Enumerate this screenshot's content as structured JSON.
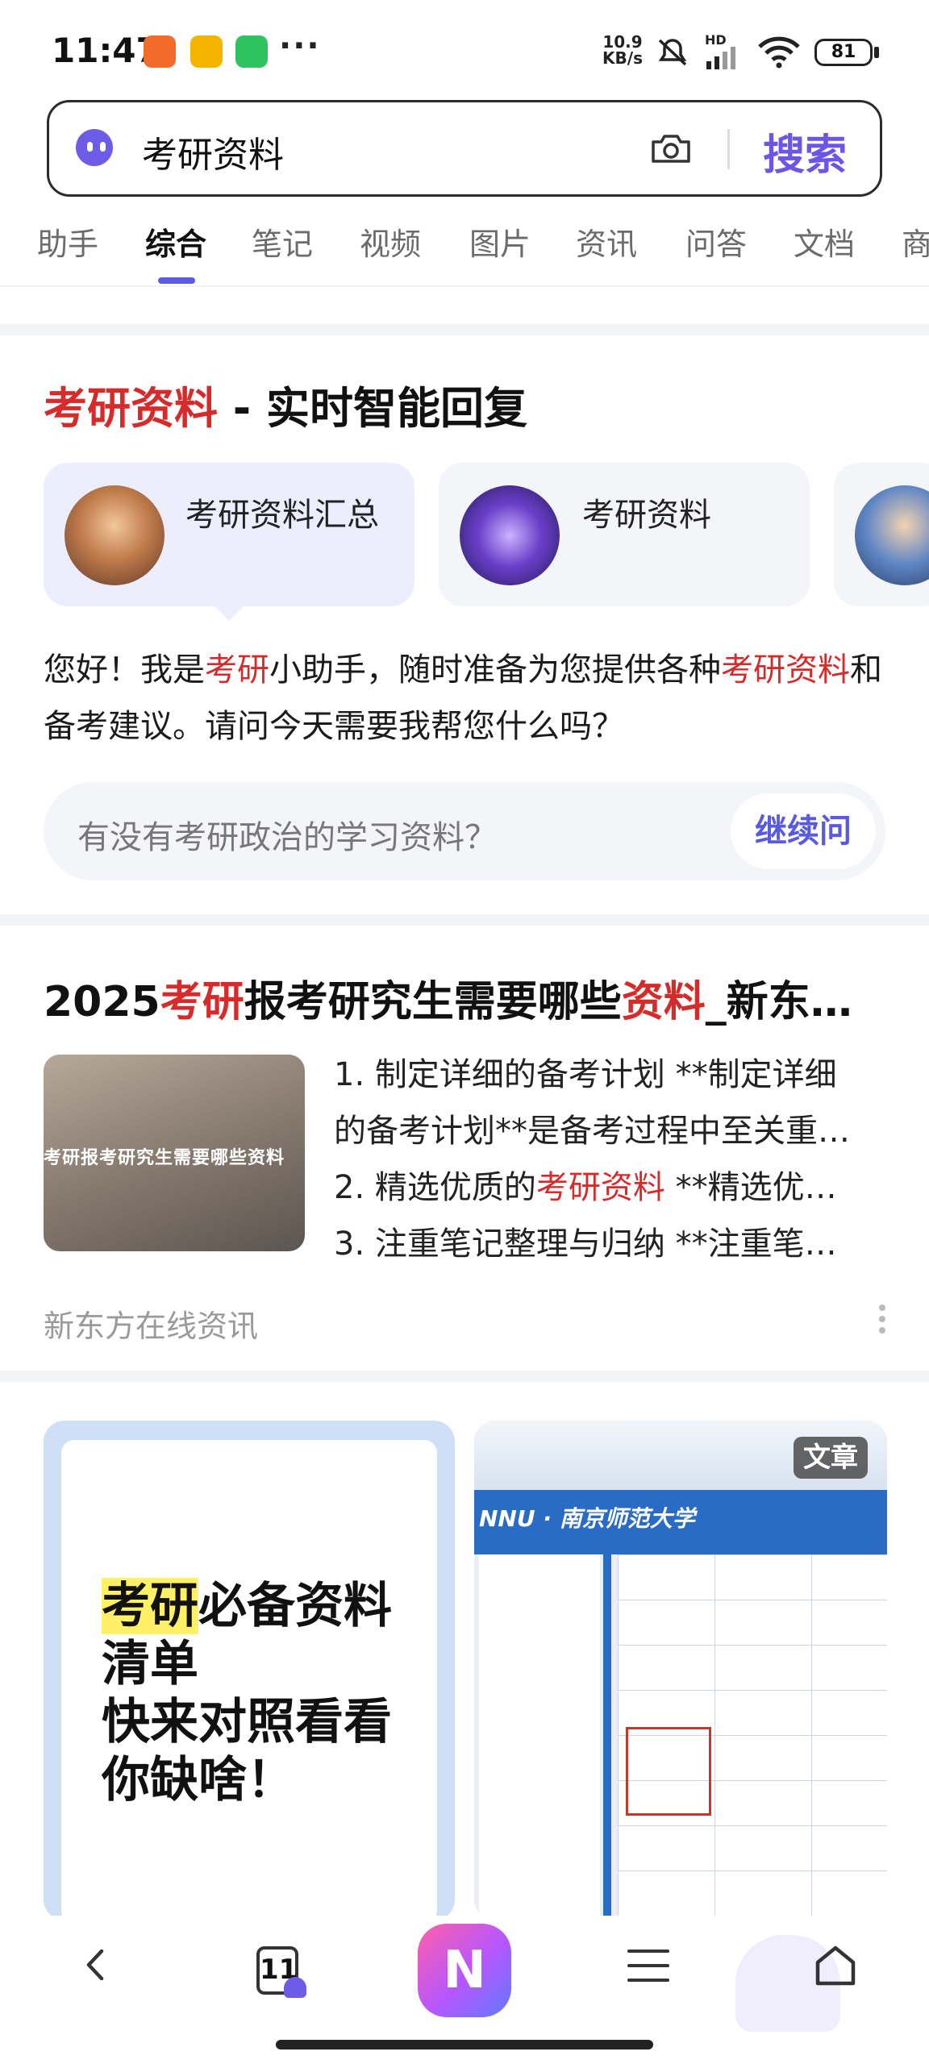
{
  "status_bar": {
    "time": "11:47",
    "more": "···",
    "speed_value": "10.9",
    "speed_unit": "KB/s",
    "network": "HD",
    "battery": "81"
  },
  "search": {
    "query": "考研资料",
    "button": "搜索"
  },
  "tabs": [
    {
      "label": "助手"
    },
    {
      "label": "综合"
    },
    {
      "label": "笔记"
    },
    {
      "label": "视频"
    },
    {
      "label": "图片"
    },
    {
      "label": "资讯"
    },
    {
      "label": "问答"
    },
    {
      "label": "文档"
    },
    {
      "label": "商"
    }
  ],
  "active_tab": "综合",
  "ai_card": {
    "title_highlight": "考研资料",
    "title_rest": " - 实时智能回复",
    "chips": [
      {
        "label": "考研资料汇总"
      },
      {
        "label": "考研资料"
      },
      {
        "label": ""
      }
    ],
    "body": {
      "p1": "您好！我是",
      "hl1": "考研",
      "p2": "小助手，随时准备为您提供各种",
      "hl2": "考研资料",
      "p3": "和备考建议。请问今天需要我帮您什么吗？"
    },
    "ask_placeholder": "有没有考研政治的学习资料？",
    "ask_button": "继续问"
  },
  "result": {
    "title_a": "2025",
    "title_hl1": "考研",
    "title_b": "报考研究生需要哪些",
    "title_hl2": "资料",
    "title_c": "_新东…",
    "thumb_text": "考研报考研究生需要哪些资料",
    "line1": "1. 制定详细的备考计划 **制定详细",
    "line2": "的备考计划**是备考过程中至关重…",
    "line3_a": "2. 精选优质的",
    "line3_hl": "考研资料",
    "line3_b": " **精选优…",
    "line4": "3. 注重笔记整理与归纳 **注重笔…",
    "source": "新东方在线资讯"
  },
  "tiles": {
    "left_hl": "考研",
    "left_line1_rest": "必备资料",
    "left_line2": "清单",
    "left_line3": "快来对照看看",
    "left_line4": "你缺啥！",
    "right_band": "NNU · 南京师范大学",
    "right_badge": "文章"
  },
  "bottom_nav": {
    "tab_count": "11",
    "ai_glyph": "N"
  },
  "colors": {
    "accent": "#6c56e8",
    "highlight_red": "#d62b2b"
  }
}
